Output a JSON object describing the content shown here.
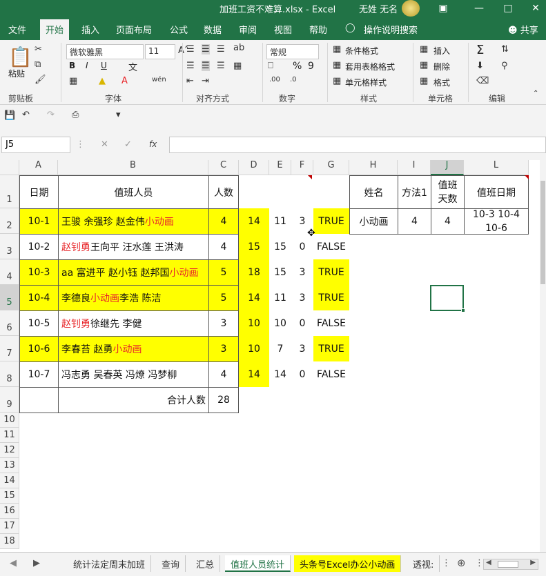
{
  "window": {
    "title": "加班工资不难算.xlsx  -  Excel",
    "user": "无姓 无名",
    "min_icon": "minimize-icon",
    "max_icon": "maximize-icon",
    "close_icon": "close-icon"
  },
  "tabs": [
    "文件",
    "开始",
    "插入",
    "页面布局",
    "公式",
    "数据",
    "审阅",
    "视图",
    "帮助",
    "操作说明搜索"
  ],
  "active_tab": "开始",
  "share": "共享",
  "ribbon": {
    "clipboard": {
      "paste": "粘贴",
      "label": "剪贴板"
    },
    "font": {
      "name": "微软雅黑",
      "size": "11",
      "bold": "B",
      "italic": "I",
      "underline": "U",
      "label": "字体"
    },
    "alignment": {
      "label": "对齐方式"
    },
    "number": {
      "format": "常规",
      "percent": "%",
      "comma": "9",
      "label": "数字"
    },
    "styles": {
      "conditional": "条件格式",
      "table": "套用表格格式",
      "cell": "单元格样式",
      "label": "样式"
    },
    "cells": {
      "insert": "插入",
      "delete": "删除",
      "format": "格式",
      "label": "单元格"
    },
    "editing": {
      "sum": "Σ",
      "label": "编辑"
    }
  },
  "namebox": "J5",
  "fx": "fx",
  "columns": [
    "A",
    "B",
    "C",
    "D",
    "E",
    "F",
    "G",
    "H",
    "I",
    "J",
    "L"
  ],
  "rows": [
    "1",
    "2",
    "3",
    "4",
    "5",
    "6",
    "7",
    "8",
    "9",
    "10",
    "11",
    "12",
    "13",
    "14",
    "15",
    "16",
    "17",
    "18"
  ],
  "table": {
    "headers": {
      "date": "日期",
      "staff": "值班人员",
      "count": "人数"
    },
    "rows": [
      {
        "date": "10-1",
        "staff": [
          "王骏 余强珍 赵金伟 ",
          "小动画"
        ],
        "red_first": false,
        "count": "4",
        "d": "14",
        "e": "11",
        "f": "3",
        "g": "TRUE",
        "yellow": true
      },
      {
        "date": "10-2",
        "staff": [
          "赵钊勇",
          " 王向平 汪水莲 王洪涛"
        ],
        "red_first": true,
        "count": "4",
        "d": "15",
        "e": "15",
        "f": "0",
        "g": "FALSE",
        "yellow": false
      },
      {
        "date": "10-3",
        "staff": [
          "aa 富进平 赵小钰 赵邦国 ",
          "小动画"
        ],
        "red_first": false,
        "count": "5",
        "d": "18",
        "e": "15",
        "f": "3",
        "g": "TRUE",
        "yellow": true
      },
      {
        "date": "10-4",
        "staff": [
          "李德良 ",
          "小动画",
          " 李浩 陈洁"
        ],
        "red_first": false,
        "count": "5",
        "d": "14",
        "e": "11",
        "f": "3",
        "g": "TRUE",
        "yellow": true
      },
      {
        "date": "10-5",
        "staff": [
          "赵钊勇",
          " 徐继先 李健"
        ],
        "red_first": true,
        "count": "3",
        "d": "10",
        "e": "10",
        "f": "0",
        "g": "FALSE",
        "yellow": false
      },
      {
        "date": "10-6",
        "staff": [
          "李春苔 赵勇 ",
          "小动画"
        ],
        "red_first": false,
        "count": "3",
        "d": "10",
        "e": "7",
        "f": "3",
        "g": "TRUE",
        "yellow": true
      },
      {
        "date": "10-7",
        "staff": [
          "冯志勇 吴春英 冯燎 冯梦柳"
        ],
        "red_first": false,
        "count": "4",
        "d": "14",
        "e": "14",
        "f": "0",
        "g": "FALSE",
        "yellow": false
      }
    ],
    "total_label": "合计人数",
    "total": "28"
  },
  "lookup": {
    "h_head": "姓名",
    "i_head": "方法1",
    "j_head": "值班天数",
    "l_head": "值班日期",
    "name": "小动画",
    "method1": "4",
    "days": "4",
    "dates": "10-3 10-4 10-6"
  },
  "sheets": [
    "统计法定周末加班",
    "查询",
    "汇总",
    "值班人员统计",
    "头条号Excel办公小动画",
    "透视:"
  ],
  "active_sheet": "值班人员统计",
  "colors": {
    "excel_green": "#217346",
    "highlight": "#ffff00",
    "red_text": "#e8262a"
  }
}
